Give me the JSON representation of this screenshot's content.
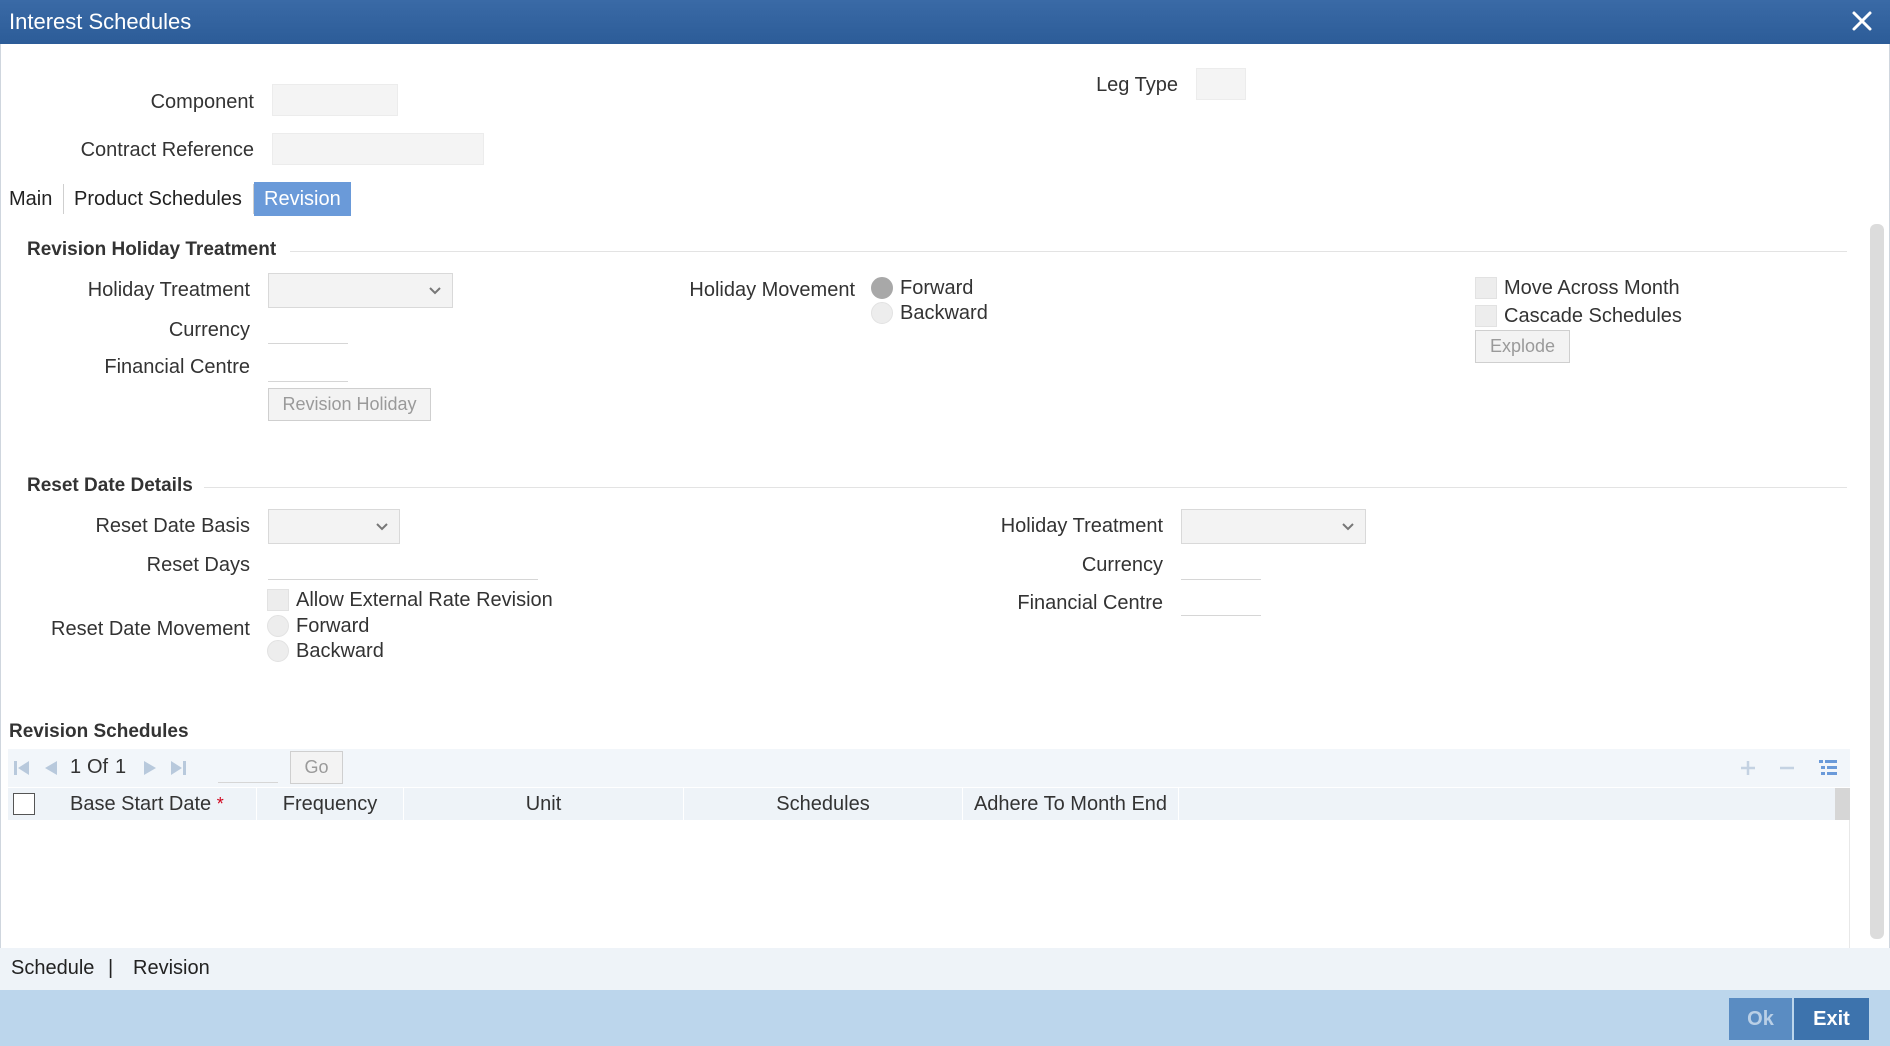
{
  "window": {
    "title": "Interest Schedules"
  },
  "header": {
    "component_label": "Component",
    "contract_reference_label": "Contract Reference",
    "leg_type_label": "Leg Type"
  },
  "tabs": [
    {
      "label": "Main"
    },
    {
      "label": "Product Schedules"
    },
    {
      "label": "Revision"
    }
  ],
  "revision_holiday": {
    "section_title": "Revision Holiday Treatment",
    "holiday_treatment_label": "Holiday Treatment",
    "currency_label": "Currency",
    "financial_centre_label": "Financial Centre",
    "revision_holiday_button": "Revision Holiday",
    "holiday_movement_label": "Holiday Movement",
    "forward_label": "Forward",
    "backward_label": "Backward",
    "holiday_movement_selected": "Forward",
    "move_across_month_label": "Move Across Month",
    "cascade_schedules_label": "Cascade Schedules",
    "explode_button": "Explode"
  },
  "reset_date": {
    "section_title": "Reset Date Details",
    "reset_date_basis_label": "Reset Date Basis",
    "reset_days_label": "Reset Days",
    "allow_external_label": "Allow External Rate Revision",
    "reset_date_movement_label": "Reset Date Movement",
    "forward_label": "Forward",
    "backward_label": "Backward",
    "holiday_treatment_label": "Holiday Treatment",
    "currency_label": "Currency",
    "financial_centre_label": "Financial Centre"
  },
  "revision_schedules": {
    "section_title": "Revision Schedules",
    "page_current": "1",
    "page_of": "Of",
    "page_total": "1",
    "go_button": "Go",
    "columns": [
      "Base Start Date",
      "Frequency",
      "Unit",
      "Schedules",
      "Adhere To Month End"
    ],
    "required_marker": "*"
  },
  "footer": {
    "links": [
      "Schedule",
      "|",
      "Revision"
    ],
    "ok_button": "Ok",
    "exit_button": "Exit"
  },
  "colors": {
    "title_bar": "#2c5c98",
    "active_tab": "#6a9ad9",
    "bottom_bar": "#bcd6ec",
    "action_button": "#3d73ad",
    "required": "#d0021b"
  },
  "icons": {
    "close": "close-icon",
    "first_page": "first-page-icon",
    "prev_page": "previous-page-icon",
    "next_page": "next-page-icon",
    "last_page": "last-page-icon",
    "add_row": "add-row-icon",
    "delete_row": "delete-row-icon",
    "single_view": "single-view-icon"
  }
}
